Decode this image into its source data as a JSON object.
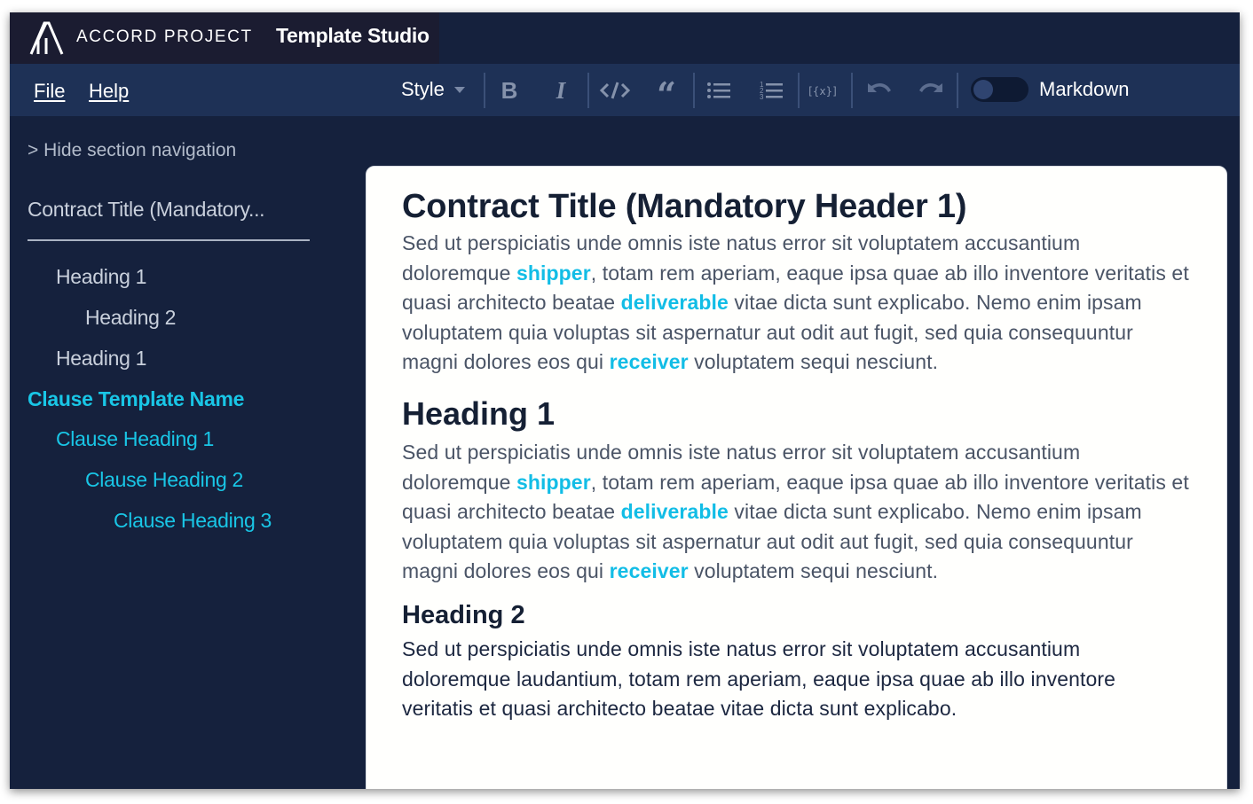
{
  "header": {
    "brand_name": "ACCORD PROJECT",
    "app_name": "Template Studio"
  },
  "toolbar": {
    "file_label": "File",
    "help_label": "Help",
    "style_label": "Style",
    "markdown_label": "Markdown",
    "buttons": [
      "bold-icon",
      "italic-icon",
      "code-icon",
      "quote-icon",
      "bulleted-list-icon",
      "numbered-list-icon",
      "variable-icon",
      "undo-icon",
      "redo-icon"
    ]
  },
  "sidebar": {
    "hide_nav_label": "> Hide section navigation",
    "contract_title": "Contract Title (Mandatory...",
    "items": [
      {
        "label": "Heading 1",
        "level": 1,
        "color": "gray"
      },
      {
        "label": "Heading 2",
        "level": 2,
        "color": "gray"
      },
      {
        "label": "Heading 1",
        "level": 1,
        "color": "gray"
      },
      {
        "label": "Clause Template Name",
        "level": 0,
        "color": "cyan"
      },
      {
        "label": "Clause Heading 1",
        "level": 1,
        "color": "cyan"
      },
      {
        "label": "Clause Heading 2",
        "level": 2,
        "color": "cyan"
      },
      {
        "label": "Clause Heading 3",
        "level": 3,
        "color": "cyan"
      }
    ]
  },
  "document": {
    "title": "Contract Title (Mandatory Header 1)",
    "para1": {
      "t1": "Sed ut perspiciatis unde omnis iste natus error sit voluptatem accusantium doloremque ",
      "v1": "shipper",
      "t2": ", totam rem aperiam, eaque ipsa quae ab illo inventore veritatis et quasi architecto beatae ",
      "v2": "deliverable",
      "t3": " vitae dicta sunt explicabo. Nemo enim ipsam voluptatem quia voluptas sit aspernatur aut odit aut fugit, sed quia consequuntur magni dolores eos qui ",
      "v3": "receiver",
      "t4": " voluptatem sequi nesciunt."
    },
    "heading1": "Heading 1",
    "para2": {
      "t1": "Sed ut perspiciatis unde omnis iste natus error sit voluptatem accusantium doloremque ",
      "v1": "shipper",
      "t2": ", totam rem aperiam, eaque ipsa quae ab illo inventore veritatis et quasi architecto beatae ",
      "v2": "deliverable",
      "t3": " vitae dicta sunt explicabo. Nemo enim ipsam voluptatem quia voluptas sit aspernatur aut odit aut fugit, sed quia consequuntur magni dolores eos qui ",
      "v3": "receiver",
      "t4": " voluptatem sequi nesciunt."
    },
    "heading2": "Heading 2",
    "para3": "Sed ut perspiciatis unde omnis iste natus error sit voluptatem accusantium doloremque laudantium, totam rem aperiam, eaque ipsa quae ab illo inventore veritatis et quasi architecto beatae vitae dicta sunt explicabo."
  },
  "colors": {
    "background": "#15213d",
    "toolbar": "#1e3156",
    "brand_bg": "#1b1c31",
    "accent_cyan": "#19c6e6",
    "heading_text": "#152034"
  }
}
